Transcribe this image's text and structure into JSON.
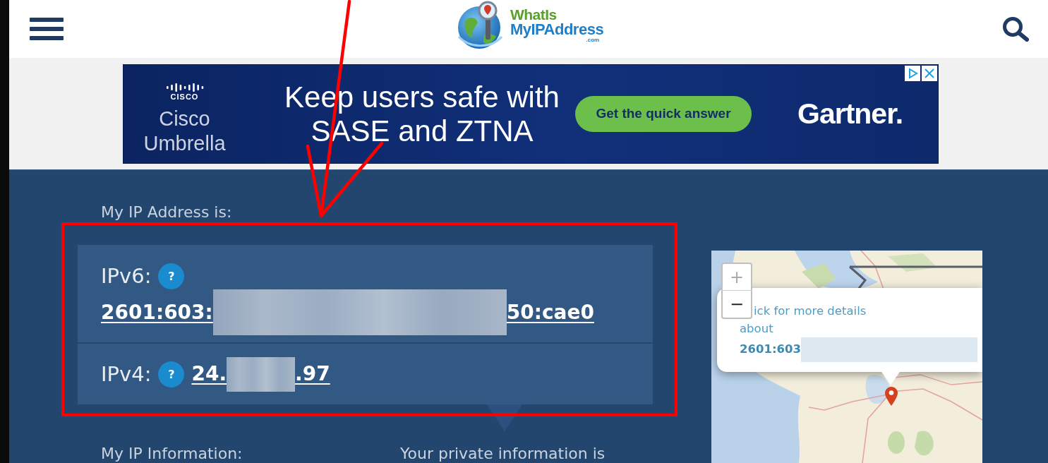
{
  "header": {
    "logo": {
      "line_1": "WhatIs",
      "line_2": "MyIPAddress",
      "suffix": ".com"
    }
  },
  "ad": {
    "brand_mark": "CISCO",
    "brand_name": "Cisco Umbrella",
    "headline": "Keep users safe with SASE and ZTNA",
    "button": "Get the quick answer",
    "sponsor": "Gartner."
  },
  "ip_panel": {
    "heading": "My IP Address is:",
    "rows": [
      {
        "label": "IPv6:",
        "help": "?",
        "address": [
          {
            "kind": "text",
            "text": "2601:603:"
          },
          {
            "kind": "blur"
          },
          {
            "kind": "text",
            "text": "50:cae0"
          }
        ]
      },
      {
        "label": "IPv4:",
        "help": "?",
        "address": [
          {
            "kind": "text",
            "text": "24."
          },
          {
            "kind": "blur"
          },
          {
            "kind": "text",
            "text": ".97"
          }
        ]
      }
    ]
  },
  "info_headings": [
    "My IP Information:",
    "Your private information is"
  ],
  "map": {
    "zoom_in": "+",
    "zoom_out": "−",
    "popup": {
      "lines": [
        "ick for more details",
        "about"
      ],
      "address": [
        {
          "kind": "text",
          "text": "2601:603"
        },
        {
          "kind": "blur"
        }
      ]
    }
  },
  "annotations": [
    {
      "kind": "arrow"
    },
    {
      "kind": "frame"
    }
  ]
}
